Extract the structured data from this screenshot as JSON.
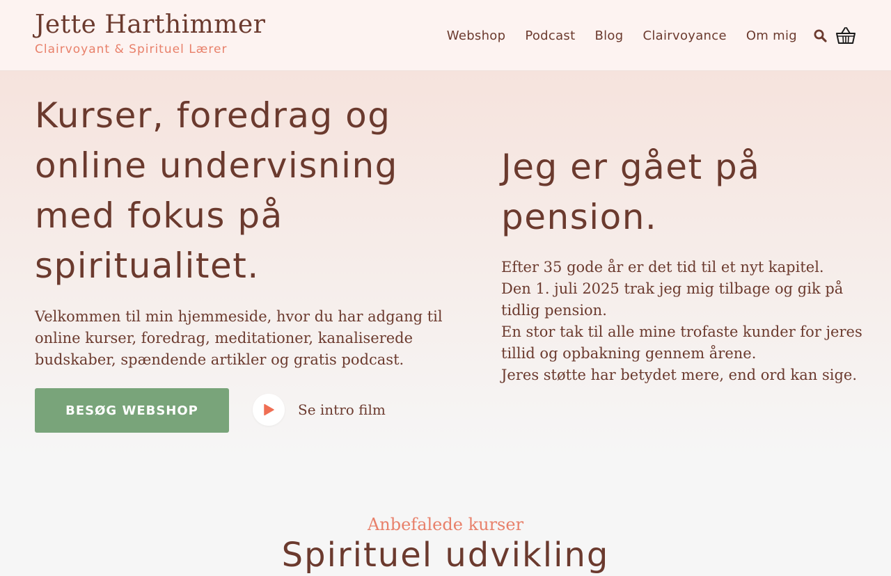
{
  "header": {
    "brand_name": "Jette Harthimmer",
    "brand_tagline": "Clairvoyant & Spirituel Lærer",
    "nav": [
      {
        "label": "Webshop"
      },
      {
        "label": "Podcast"
      },
      {
        "label": "Blog"
      },
      {
        "label": "Clairvoyance"
      },
      {
        "label": "Om mig"
      }
    ],
    "icons": [
      "search-icon",
      "basket-icon"
    ]
  },
  "hero": {
    "title": "Kurser, foredrag og online undervisning med fokus på spiritualitet.",
    "intro": "Velkommen til min hjemmeside, hvor du har adgang til online kurser, foredrag, meditationer, kanaliserede budskaber, spændende artikler og gratis podcast.",
    "cta_label": "BESØG WEBSHOP",
    "video_label": "Se intro film",
    "video_icon": "play-icon"
  },
  "retirement": {
    "title": "Jeg er gået på pension.",
    "lines": [
      "Efter 35 gode år er det tid til et nyt kapitel.",
      "Den 1. juli 2025 trak jeg mig tilbage og gik på tidlig pension.",
      "En stor tak til alle mine trofaste kunder for jeres tillid og opbakning gennem årene.",
      "Jeres støtte har betydet mere, end ord kan sige."
    ]
  },
  "courses": {
    "eyebrow": "Anbefalede kurser",
    "title": "Spirituel udvikling"
  },
  "colors": {
    "text_brown": "#6b3a2e",
    "accent_coral": "#e8806a",
    "cta_green": "#79a47a",
    "header_bg": "#fdf3f1"
  }
}
